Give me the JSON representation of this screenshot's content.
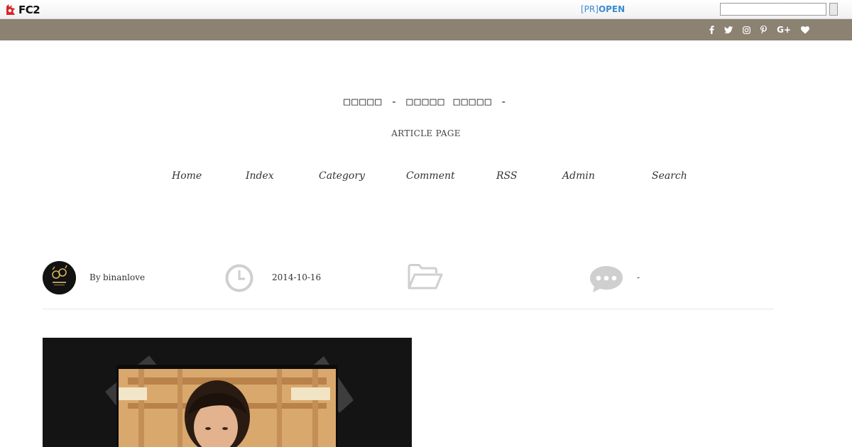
{
  "fc2bar": {
    "logo_text": "FC2",
    "pr_prefix": "[PR]",
    "pr_open": "OPEN",
    "search_placeholder": ""
  },
  "social": {
    "icons": [
      "facebook-icon",
      "twitter-icon",
      "instagram-icon",
      "pinterest-icon",
      "google-plus-icon",
      "heart-icon"
    ],
    "labels": [
      "f",
      "",
      "",
      "P",
      "G+",
      "♥"
    ],
    "bar_color": "#8c8272"
  },
  "header": {
    "title": "□□□□□ - □□□□□ □□□□□ -",
    "page_label": "ARTICLE PAGE"
  },
  "nav": {
    "items": [
      "Home",
      "Index",
      "Category",
      "Comment",
      "RSS",
      "Admin",
      "Search"
    ]
  },
  "meta": {
    "by_label": "By",
    "author": "binanlove",
    "date": "2014-10-16",
    "comments": "-"
  },
  "colors": {
    "accent_link": "#3b8bd1",
    "icon_gray": "#cfcfcf"
  }
}
